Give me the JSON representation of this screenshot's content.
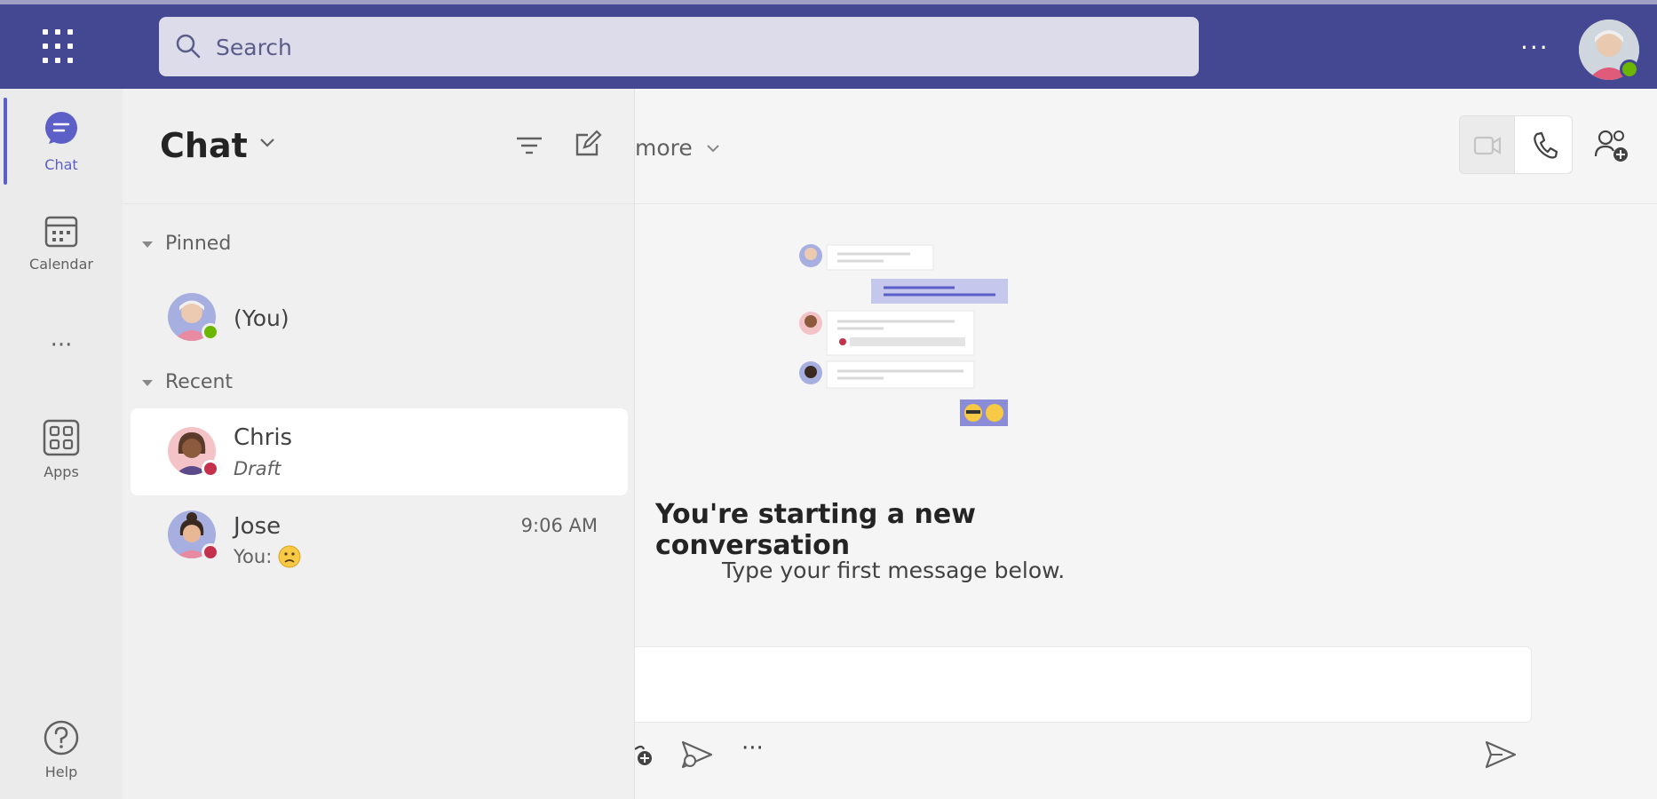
{
  "topbar": {
    "search_placeholder": "Search",
    "more_label": "···"
  },
  "rail": {
    "items": [
      {
        "label": "Chat",
        "icon": "chat-icon",
        "active": true
      },
      {
        "label": "Calendar",
        "icon": "calendar-icon"
      },
      {
        "label": "···",
        "icon": "more-icon"
      },
      {
        "label": "Apps",
        "icon": "apps-icon"
      },
      {
        "label": "Help",
        "icon": "help-icon"
      }
    ]
  },
  "chatpane": {
    "title": "Chat",
    "sections": {
      "pinned": "Pinned",
      "recent": "Recent"
    },
    "pinned": [
      {
        "name": "(You)",
        "status": "available"
      }
    ],
    "recent": [
      {
        "name": "Chris",
        "preview": "Draft",
        "time": "",
        "status": "busy",
        "selected": true
      },
      {
        "name": "Jose",
        "preview": "You: ",
        "time": "9:06 AM",
        "status": "busy"
      }
    ]
  },
  "main": {
    "header_more": "more",
    "conversation_title": "You're starting a new conversation",
    "conversation_subtitle": "Type your first message below."
  },
  "colors": {
    "brand": "#444791",
    "accent": "#5b5fc7",
    "available": "#6bb700",
    "busy": "#c4314b"
  }
}
